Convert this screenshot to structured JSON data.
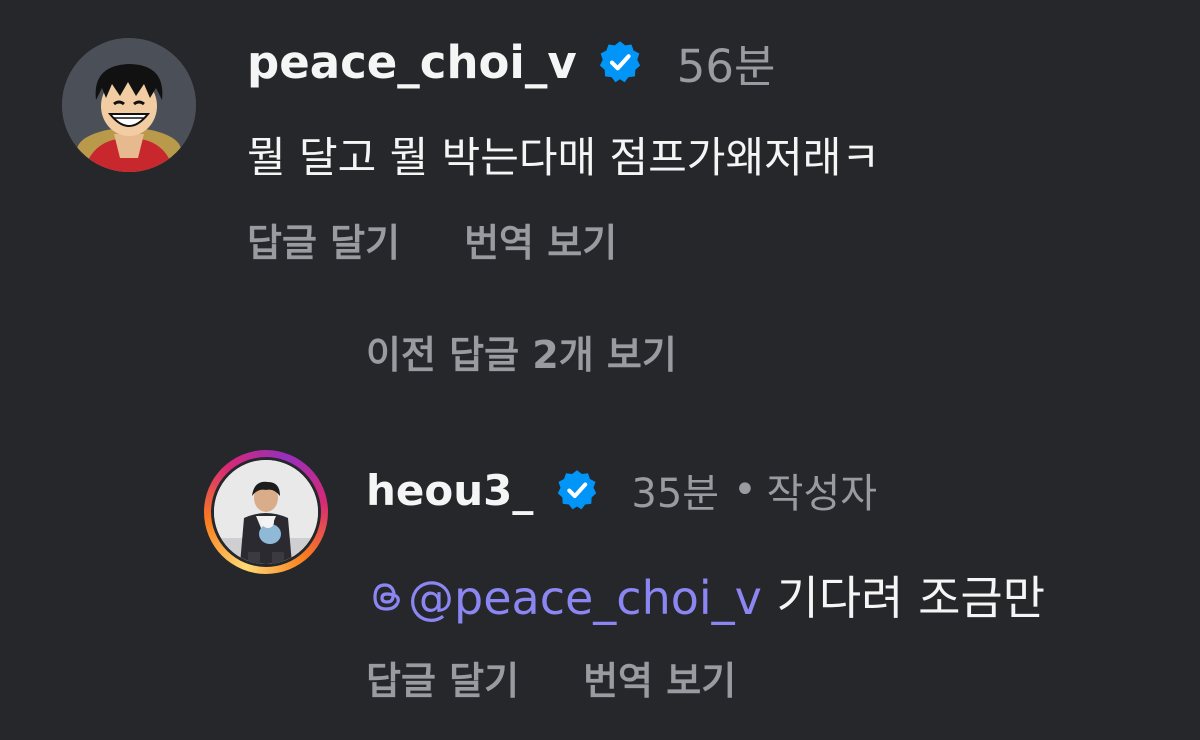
{
  "comments": [
    {
      "username": "peace_choi_v",
      "verified": true,
      "time": "56분",
      "text": "뭘 달고 뭘 박는다매 점프가왜저래ㅋ",
      "actions": {
        "reply": "답글 달기",
        "translate": "번역 보기"
      },
      "avatar_icon": "anime-character-avatar"
    }
  ],
  "view_replies": "이전 답글 2개 보기",
  "replies": [
    {
      "username": "heou3_",
      "verified": true,
      "time": "35분",
      "separator": "•",
      "author_tag": "작성자",
      "mention": "@peace_choi_v",
      "text": " 기다려 조금만",
      "actions": {
        "reply": "답글 달기",
        "translate": "번역 보기"
      },
      "avatar_icon": "person-photo-avatar",
      "story_ring": true
    }
  ],
  "colors": {
    "background": "#26272b",
    "primary_text": "#f5f5f5",
    "secondary_text": "#9a9ba1",
    "mention": "#8c86f3",
    "verified_badge": "#0095f6"
  }
}
